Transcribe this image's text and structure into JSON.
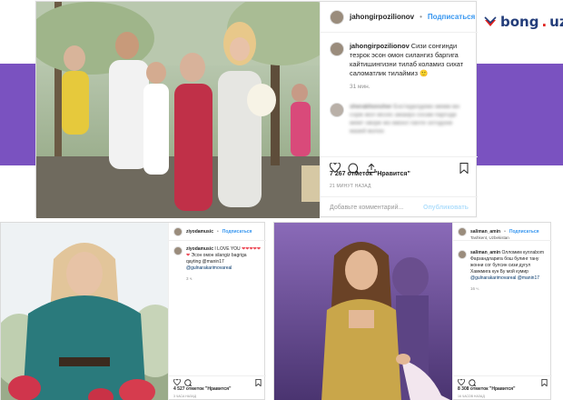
{
  "site_logo": {
    "text_main": "bong",
    "text_dot": ".",
    "text_tld": "uz"
  },
  "top_post": {
    "username": "jahongirpozilionov",
    "separator": "•",
    "follow_label": "Подписаться",
    "caption_user": "jahongirpozilionov",
    "caption_text": "Сизи сонгинди тезрок эсон омон силангиз баргига кайтишингизни тилаб коламиз сихат саломатлик тилаймиз",
    "caption_emoji": "🙂",
    "time_ago": "31 мин.",
    "comment_user": "sherakhonsher",
    "comment_text": "Бостеделдемо мемм мн сорж мол мссес ажаирэ сосам паргоде мемт оворе мо кмонл пачте охтодоне мазей волоо",
    "likes": "7 267 отметок \"Нравится\"",
    "date": "21 МИНУТ НАЗАД",
    "add_comment_placeholder": "Добавьте комментарий...",
    "publish_label": "Опубликовать"
  },
  "bottom_left_post": {
    "username": "ziyodamusic",
    "separator": "•",
    "follow_label": "Подписаться",
    "caption_user": "ziyodamusic",
    "caption_text": "I LOVE YOU",
    "caption_hearts": "❤❤❤❤❤❤",
    "caption_text2": "Эсон омон silangiz bagriga qayting @manin17",
    "caption_mention": "@gulnarakarimovareal",
    "time_ago": "3 ч.",
    "likes": "4 527 отметок \"Нравится\"",
    "date": "3 ЧАСА НАЗАД"
  },
  "bottom_right_post": {
    "username": "saliman_amin",
    "separator": "•",
    "follow_label": "Подписаться",
    "location": "Tashkent, Uzbekistan",
    "caption_user": "saliman_amin",
    "caption_text": "Олломим куллаbоm Фарзандларига бош булинг тану жонни сог булсин сизи дугул Хамкмига кун Бу мой кумир",
    "caption_mention": "@gulnarakarimovareal @manin17",
    "time_ago": "16 ч.",
    "likes": "8 308 отметок \"Нравится\"",
    "date": "16 ЧАСОВ НАЗАД"
  },
  "colors": {
    "purple_band": "#7a52c0",
    "instagram_blue": "#3897f0",
    "logo_navy": "#233d7a",
    "logo_red": "#e0211d"
  }
}
